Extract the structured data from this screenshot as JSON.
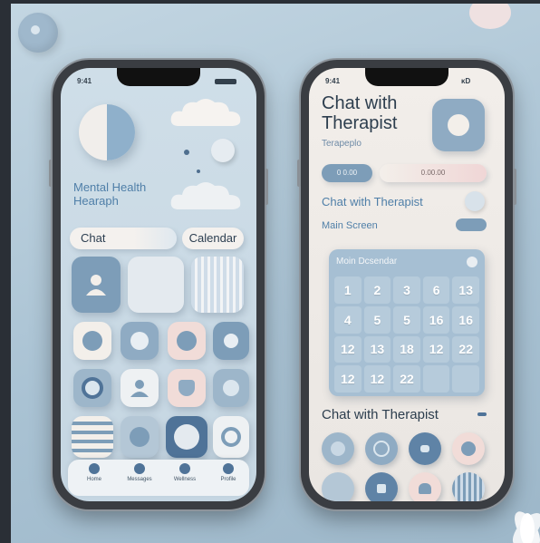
{
  "left_phone": {
    "status_time": "9:41",
    "app_title_line1": "Mental Health",
    "app_title_line2": "Hearaph",
    "chat_button": "Chat",
    "calendar_button": "Calendar",
    "tabs": [
      {
        "label": "Home",
        "icon": "home-icon"
      },
      {
        "label": "Messages",
        "icon": "messages-icon"
      },
      {
        "label": "Wellness",
        "icon": "wellness-icon"
      },
      {
        "label": "Profile",
        "icon": "profile-icon"
      }
    ]
  },
  "right_phone": {
    "status_time": "9:41",
    "status_right": "ᴋD",
    "title_line1": "Chat with",
    "title_line2": "Therapist",
    "subtitle": "Terapeplo",
    "filter_1": "0 0.00",
    "filter_2": "0.00.00",
    "chat_label": "Chat with Therapist",
    "main_screen_label": "Main Screen",
    "calendar_title": "Moin Dcsendar",
    "calendar_cells": [
      "1",
      "2",
      "3",
      "6",
      "13",
      "4",
      "5",
      "5",
      "16",
      "16",
      "12",
      "13",
      "18",
      "12",
      "22",
      "12",
      "12",
      "22",
      "",
      ""
    ],
    "bottom_label": "Chat with Therapist"
  },
  "colors": {
    "accent_blue": "#4f7fa8",
    "tile_blue": "#7d9db8",
    "blush": "#f1d9d6",
    "cream": "#f3efea"
  }
}
